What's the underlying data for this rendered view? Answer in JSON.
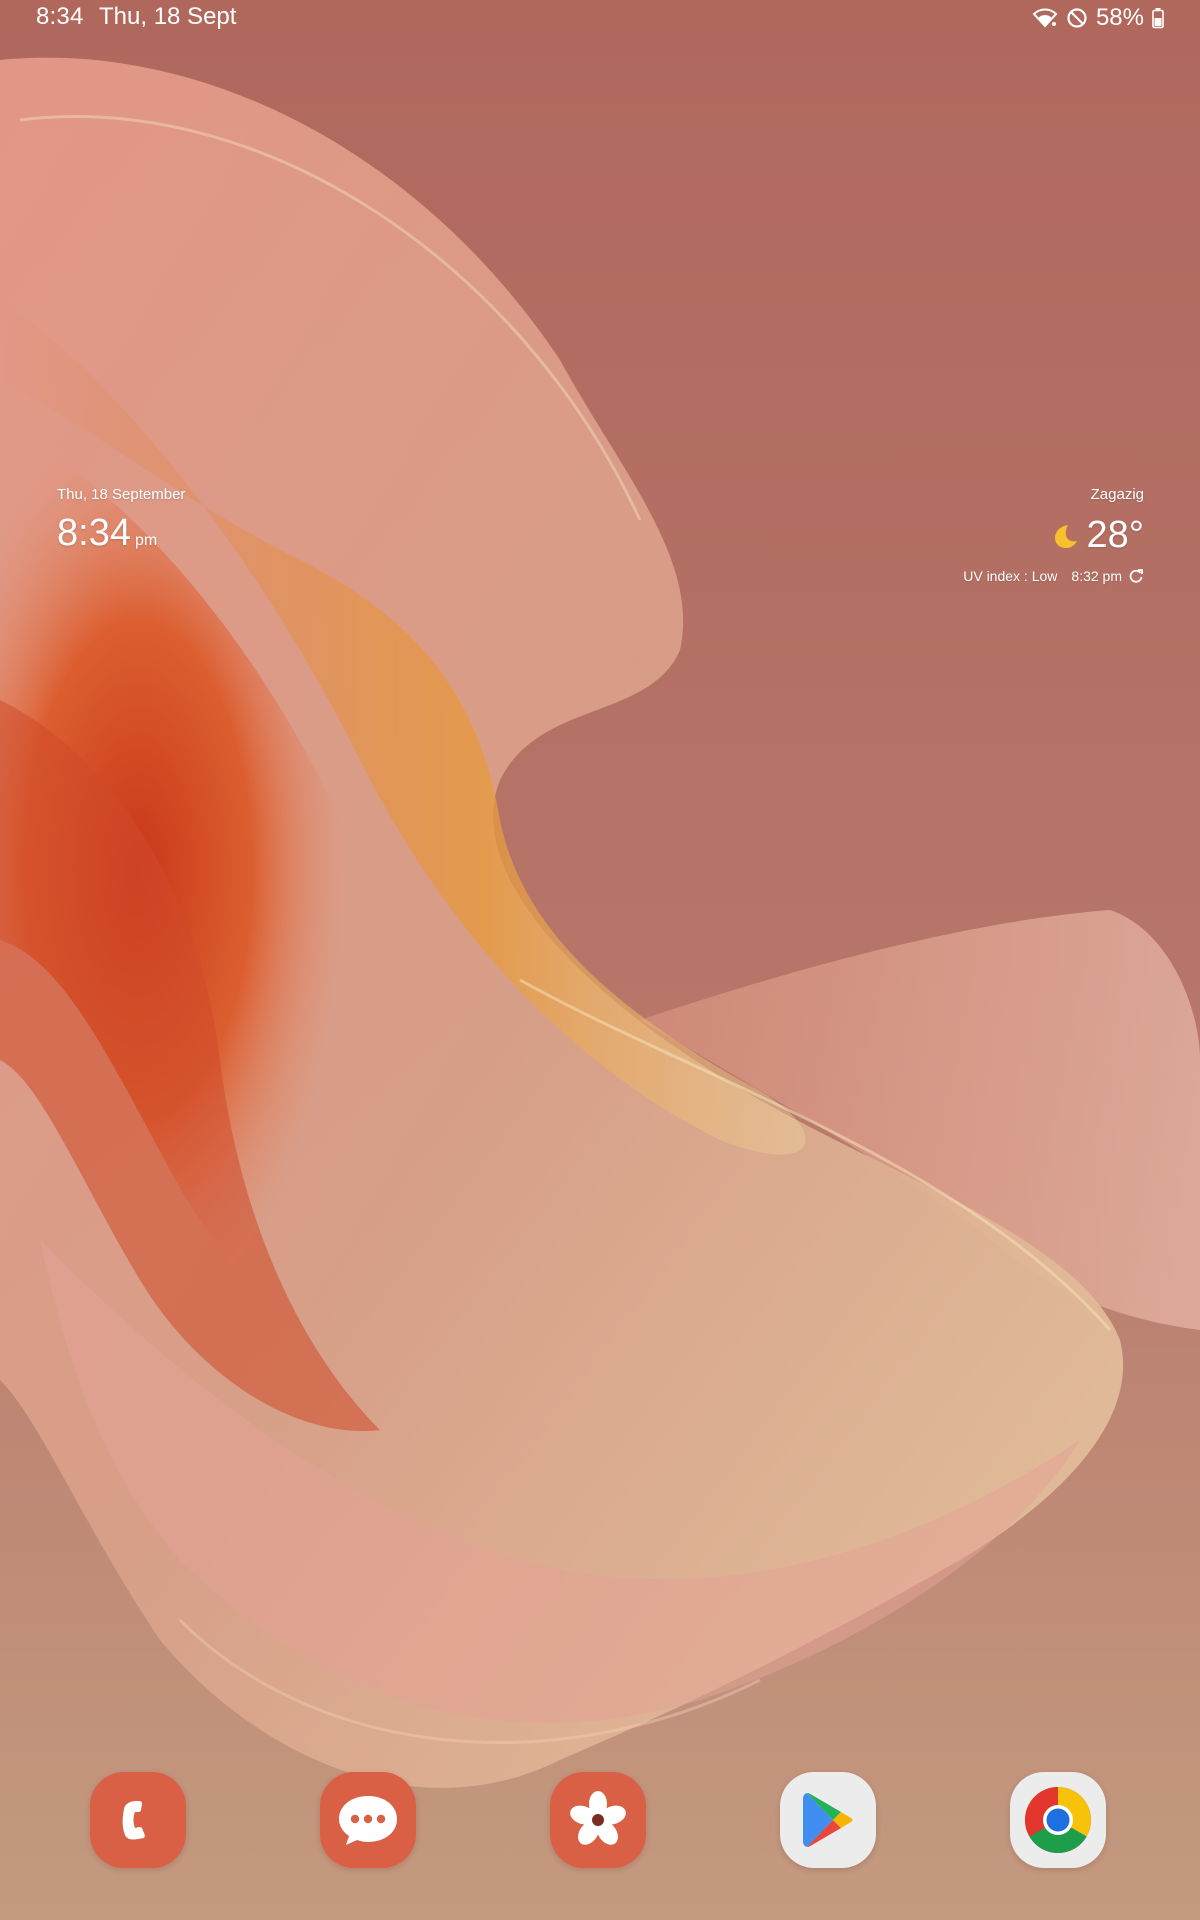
{
  "status_bar": {
    "time": "8:34",
    "date": "Thu, 18 Sept",
    "battery": "58%",
    "icons": [
      "wifi-icon",
      "do-not-disturb-icon",
      "battery-icon"
    ]
  },
  "clock_widget": {
    "date": "Thu, 18 September",
    "time": "8:34",
    "ampm": "pm"
  },
  "weather_widget": {
    "city": "Zagazig",
    "temperature": "28°",
    "condition_icon": "moon-icon",
    "uv_index": "UV index : Low",
    "updated_time": "8:32 pm"
  },
  "dock": {
    "apps": [
      {
        "name": "Phone",
        "icon": "phone-icon"
      },
      {
        "name": "Messages",
        "icon": "messages-icon"
      },
      {
        "name": "Gallery",
        "icon": "gallery-icon"
      },
      {
        "name": "Play Store",
        "icon": "play-store-icon"
      },
      {
        "name": "Chrome",
        "icon": "chrome-icon"
      }
    ]
  },
  "colors": {
    "wallpaper_base": "#b66e62",
    "accent_orange": "#d95f45",
    "moon_yellow": "#f6c02e"
  }
}
